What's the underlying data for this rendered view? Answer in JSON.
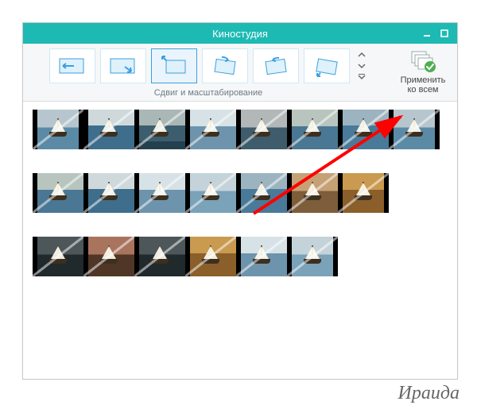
{
  "window": {
    "title": "Киностудия"
  },
  "ribbon": {
    "group_label": "Сдвиг и масштабирование",
    "apply_label_line1": "Применить",
    "apply_label_line2": "ко всем",
    "selected_index": 2
  },
  "signature": "Ираида"
}
